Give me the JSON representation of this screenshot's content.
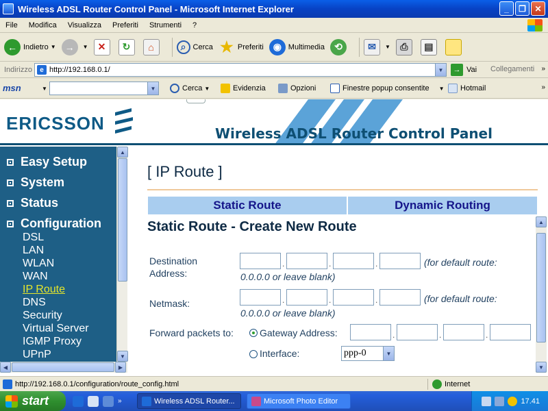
{
  "window": {
    "title": "Wireless ADSL Router Control Panel - Microsoft Internet Explorer"
  },
  "menu": [
    "File",
    "Modifica",
    "Visualizza",
    "Preferiti",
    "Strumenti",
    "?"
  ],
  "toolbar": {
    "back": "Indietro",
    "search": "Cerca",
    "favorites": "Preferiti",
    "media": "Multimedia"
  },
  "address": {
    "label": "Indirizzo",
    "url": "http://192.168.0.1/",
    "go": "Vai",
    "links": "Collegamenti"
  },
  "msnbar": {
    "logo": "msn",
    "search": "Cerca",
    "highlight": "Evidenzia",
    "options": "Opzioni",
    "popups": "Finestre popup consentite",
    "hotmail": "Hotmail"
  },
  "banner": {
    "logo": "ERICSSON",
    "title": "Wireless ADSL Router Control Panel"
  },
  "nav": {
    "sections": [
      "Easy Setup",
      "System",
      "Status",
      "Configuration"
    ],
    "items": [
      "DSL",
      "LAN",
      "WLAN",
      "WAN",
      "IP Route",
      "DNS",
      "Security",
      "Virtual Server",
      "IGMP Proxy",
      "UPnP"
    ],
    "active": "IP Route"
  },
  "main": {
    "title": "[ IP Route ]",
    "tabs": [
      "Static Route",
      "Dynamic Routing"
    ],
    "subtitle": "Static Route - Create New Route",
    "dest_label_1": "Destination",
    "dest_label_2": "Address:",
    "dest_hint_1": "(for default route:",
    "dest_hint_2": "0.0.0.0 or leave blank)",
    "mask_label": "Netmask:",
    "mask_hint_1": "(for default route:",
    "mask_hint_2": "0.0.0.0 or leave blank)",
    "forward_label": "Forward packets to:",
    "gateway_label": "Gateway Address:",
    "interface_label": "Interface:",
    "interface_value": "ppp-0"
  },
  "status": {
    "url": "http://192.168.0.1/configuration/route_config.html",
    "zone": "Internet"
  },
  "taskbar": {
    "start": "start",
    "task1": "Wireless ADSL Router...",
    "task2": "Microsoft Photo Editor",
    "clock": "17.41"
  },
  "colors": {
    "nav_bg": "#1E5F86",
    "tab_bg": "#A9CDEF",
    "tab_text": "#15158A",
    "active_nav": "#E6E62A"
  }
}
